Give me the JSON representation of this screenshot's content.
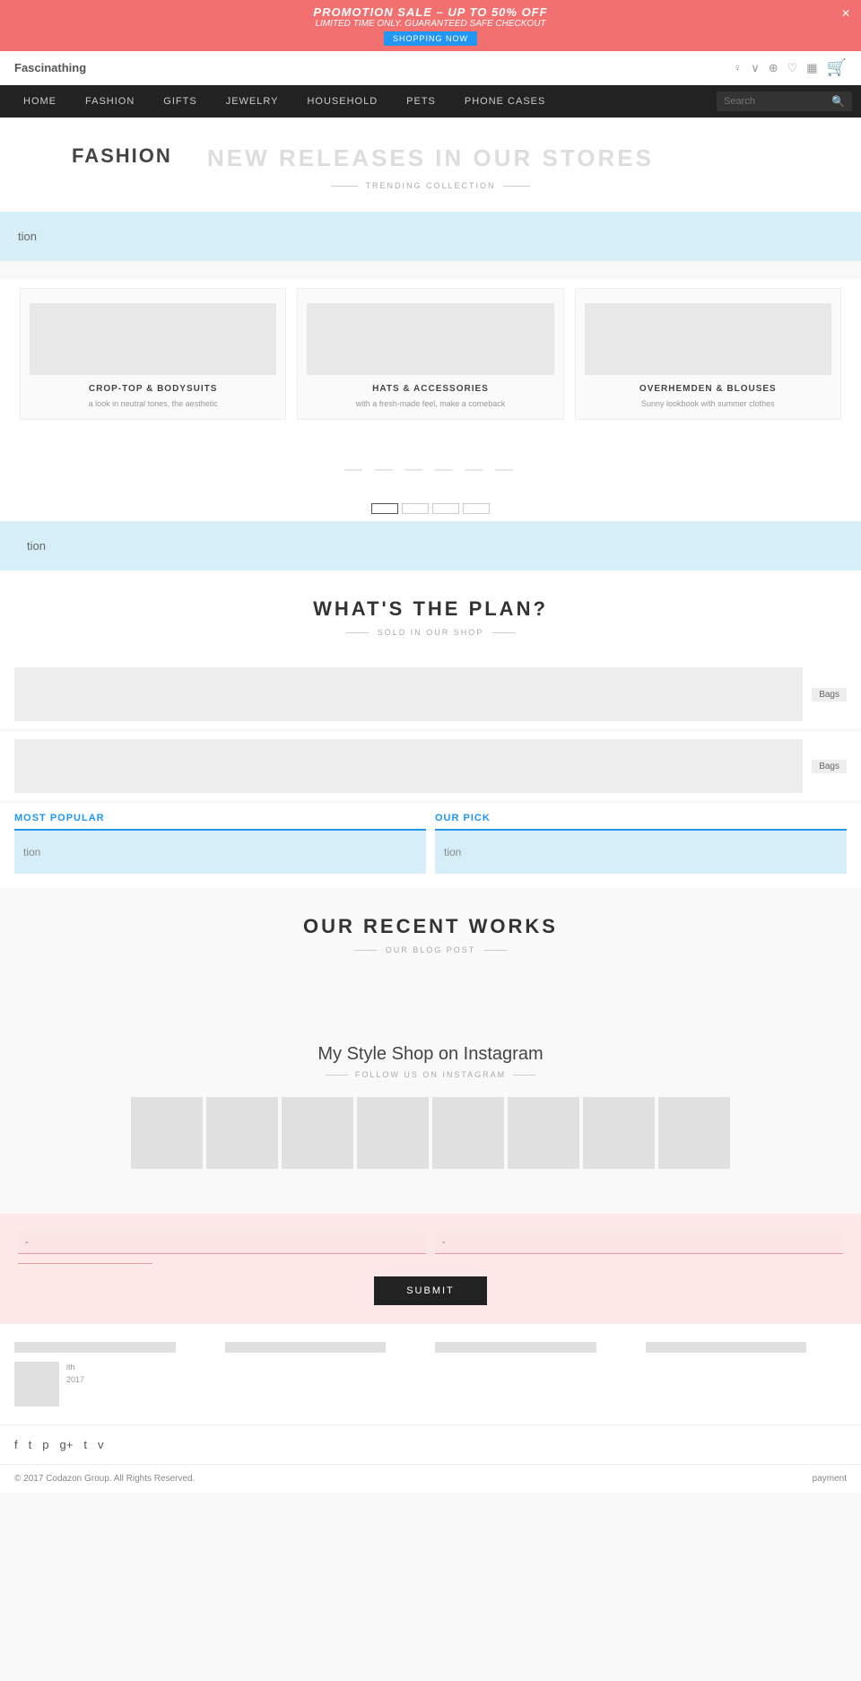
{
  "promo": {
    "title": "PROMOTION SALE – UP TO 50% OFF",
    "subtitle": "LIMITED TIME ONLY. GUARANTEED SAFE CHECKOUT",
    "button_label": "SHOPPING NOW",
    "close_label": "✕"
  },
  "topbar": {
    "brand": "Fascinathing",
    "icons": [
      "♀",
      "∨",
      "⊕",
      "♡",
      "▦"
    ]
  },
  "cart": {
    "icon": "🛒"
  },
  "nav": {
    "items": [
      "HOME",
      "FASHION",
      "GIFTS",
      "JEWELRY",
      "HOUSEHOLD",
      "PETS",
      "PHONE CASES"
    ],
    "search_placeholder": "Search"
  },
  "hero": {
    "title": "NEW RELEASES IN OUR STORES",
    "subtitle": "TRENDING COLLECTION",
    "fashion_label": "FASHIOn"
  },
  "hero_slider": {
    "text": "tion"
  },
  "categories": [
    {
      "title": "CROP-TOP & BODYSUITS",
      "desc": "a look in neutral tones, the aesthetic"
    },
    {
      "title": "HATS & ACCESSORIES",
      "desc": "with a fresh-made feel, make a comeback"
    },
    {
      "title": "OVERHEMDEN & BLOUSES",
      "desc": "Sunny lookbook with summer clothes"
    }
  ],
  "section2": {
    "title_dashes": "— — — — — —",
    "tabs": [
      "",
      "",
      "",
      ""
    ]
  },
  "slider2": {
    "text": "tion"
  },
  "whats_plan": {
    "heading": "WHAT'S THE PLAN?",
    "subtext": "SOLD IN OUR SHOP"
  },
  "products": [
    {
      "badge": "Bags"
    },
    {
      "badge": "Bags"
    }
  ],
  "featured": {
    "most_popular_label": "MOST POPULAR",
    "our_pick_label": "OUR PICK",
    "slider1_text": "tion",
    "slider2_text": "tion"
  },
  "recent_works": {
    "heading": "OUR RECENT WORKS",
    "subtext": "OUR BLOG POST"
  },
  "instagram": {
    "title": "My Style Shop on Instagram",
    "subtext": "FOLLOW US ON INSTAGRAM"
  },
  "newsletter": {
    "placeholder1": "-",
    "placeholder2": "-",
    "submit_label": "SUBMIT"
  },
  "footer": {
    "col1_text_suffix": "ith",
    "col1_year": "2017",
    "copyright": "© 2017 Codazon Group. All Rights Reserved.",
    "payment_label": "payment"
  },
  "social": {
    "icons": [
      "f",
      "t",
      "p",
      "g+",
      "t",
      "v"
    ]
  }
}
